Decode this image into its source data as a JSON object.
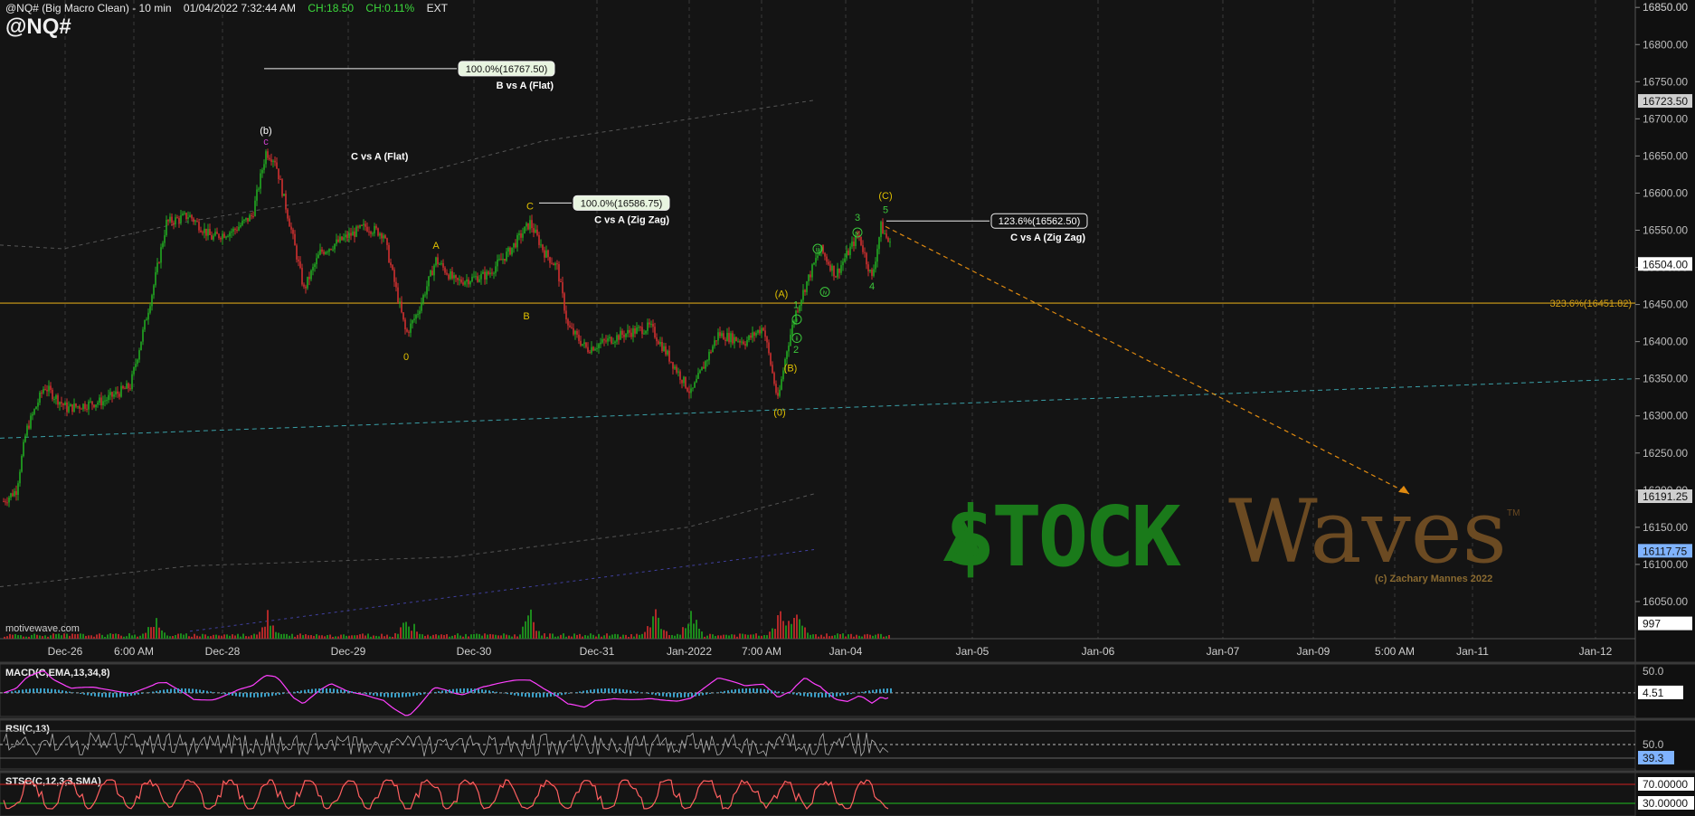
{
  "header": {
    "symbol_line": "@NQ# (Big Macro Clean) - 10 min",
    "datetime": "01/04/2022 7:32:44 AM",
    "change": "CH:18.50",
    "change_pct": "CH:0.11%",
    "session": "EXT",
    "symbol": "@NQ#"
  },
  "watermark": "motivewave.com",
  "logo": {
    "part1": "$TOCK",
    "part2": "Waves",
    "tm": "TM",
    "copyright": "(c) Zachary Mannes 2022"
  },
  "colors": {
    "background": "#141414",
    "up_candle": "#22aa22",
    "down_candle": "#d03030",
    "horizontal_level": "#d4a017",
    "projection": "#e08a10",
    "channel": "#3aa0a8",
    "label_yellow": "#e0c000",
    "label_green": "#3cc83c",
    "label_magenta": "#d040d0",
    "macd_line": "#ff40ff",
    "rsi_line": "#b0b0b0",
    "stoch_k": "#ff6060"
  },
  "chart_data": {
    "type": "candlestick",
    "instrument": "@NQ#",
    "timeframe": "10 min",
    "ylim": [
      16000,
      16860
    ],
    "y_ticks": [
      16050,
      16100,
      16150,
      16200,
      16250,
      16300,
      16350,
      16400,
      16450,
      16500,
      16550,
      16600,
      16650,
      16700,
      16750,
      16800,
      16850
    ],
    "x_ticks": [
      "Dec-26",
      "6:00 AM",
      "Dec-28",
      "Dec-29",
      "Dec-30",
      "Dec-31",
      "Jan-2022",
      "7:00 AM",
      "Jan-04",
      "Jan-05",
      "Jan-06",
      "Jan-07",
      "Jan-09",
      "5:00 AM",
      "Jan-11",
      "Jan-12"
    ],
    "price_tags": [
      {
        "text": "16850.00"
      },
      {
        "text": "16723.50"
      },
      {
        "text": "16504.00"
      },
      {
        "text": "16191.25"
      },
      {
        "text": "16117.75"
      },
      {
        "text": "997"
      }
    ],
    "path_points": [
      {
        "t": 0,
        "p": 16185
      },
      {
        "t": 14,
        "p": 16200
      },
      {
        "t": 25,
        "p": 16280
      },
      {
        "t": 45,
        "p": 16340
      },
      {
        "t": 70,
        "p": 16310
      },
      {
        "t": 110,
        "p": 16320
      },
      {
        "t": 140,
        "p": 16340
      },
      {
        "t": 165,
        "p": 16470
      },
      {
        "t": 180,
        "p": 16560
      },
      {
        "t": 205,
        "p": 16570
      },
      {
        "t": 230,
        "p": 16540
      },
      {
        "t": 255,
        "p": 16550
      },
      {
        "t": 275,
        "p": 16570
      },
      {
        "t": 290,
        "p": 16655
      },
      {
        "t": 300,
        "p": 16645
      },
      {
        "t": 318,
        "p": 16550
      },
      {
        "t": 332,
        "p": 16470
      },
      {
        "t": 350,
        "p": 16520
      },
      {
        "t": 378,
        "p": 16540
      },
      {
        "t": 400,
        "p": 16555
      },
      {
        "t": 420,
        "p": 16545
      },
      {
        "t": 445,
        "p": 16410
      },
      {
        "t": 458,
        "p": 16440
      },
      {
        "t": 478,
        "p": 16510
      },
      {
        "t": 500,
        "p": 16480
      },
      {
        "t": 535,
        "p": 16490
      },
      {
        "t": 558,
        "p": 16520
      },
      {
        "t": 582,
        "p": 16560
      },
      {
        "t": 598,
        "p": 16520
      },
      {
        "t": 612,
        "p": 16500
      },
      {
        "t": 624,
        "p": 16420
      },
      {
        "t": 645,
        "p": 16390
      },
      {
        "t": 685,
        "p": 16410
      },
      {
        "t": 715,
        "p": 16420
      },
      {
        "t": 745,
        "p": 16360
      },
      {
        "t": 760,
        "p": 16330
      },
      {
        "t": 790,
        "p": 16410
      },
      {
        "t": 820,
        "p": 16400
      },
      {
        "t": 840,
        "p": 16420
      },
      {
        "t": 856,
        "p": 16320
      },
      {
        "t": 866,
        "p": 16390
      },
      {
        "t": 876,
        "p": 16440
      },
      {
        "t": 888,
        "p": 16480
      },
      {
        "t": 903,
        "p": 16525
      },
      {
        "t": 920,
        "p": 16490
      },
      {
        "t": 945,
        "p": 16545
      },
      {
        "t": 960,
        "p": 16485
      },
      {
        "t": 970,
        "p": 16555
      },
      {
        "t": 980,
        "p": 16530
      }
    ],
    "horizontal_levels": [
      {
        "price": 16451.82,
        "label": "323.6%(16451.82)"
      }
    ],
    "fib_labels": [
      {
        "box": "100.0%(16767.50)",
        "sub": "B vs A (Flat)",
        "price": 16767.5
      },
      {
        "box": "100.0%(16586.75)",
        "sub": "C vs A (Zig Zag)",
        "price": 16586.75
      },
      {
        "box": "123.6%(16562.50)",
        "sub": "C vs A (Zig Zag)",
        "price": 16562.5
      }
    ],
    "annotations": [
      {
        "text": "C vs A (Flat)"
      }
    ],
    "wave_labels": [
      {
        "text": "(b)",
        "color": "white",
        "t": 290,
        "p": 16680
      },
      {
        "text": "c",
        "color": "magenta",
        "t": 290,
        "p": 16665
      },
      {
        "text": "A",
        "color": "yellow",
        "t": 478,
        "p": 16525
      },
      {
        "text": "B",
        "color": "yellow",
        "t": 578,
        "p": 16430
      },
      {
        "text": "C",
        "color": "yellow",
        "t": 582,
        "p": 16578
      },
      {
        "text": "0",
        "color": "yellow",
        "t": 445,
        "p": 16375
      },
      {
        "text": "(A)",
        "color": "yellow",
        "t": 860,
        "p": 16460
      },
      {
        "text": "(B)",
        "color": "yellow",
        "t": 870,
        "p": 16360
      },
      {
        "text": "(0)",
        "color": "yellow",
        "t": 858,
        "p": 16300
      },
      {
        "text": "(C)",
        "color": "yellow",
        "t": 975,
        "p": 16592
      },
      {
        "text": "1",
        "color": "green",
        "t": 876,
        "p": 16445
      },
      {
        "text": "2",
        "color": "green",
        "t": 876,
        "p": 16385
      },
      {
        "text": "3",
        "color": "green",
        "t": 944,
        "p": 16563
      },
      {
        "text": "4",
        "color": "green",
        "t": 960,
        "p": 16470
      },
      {
        "text": "5",
        "color": "green",
        "t": 975,
        "p": 16573
      }
    ],
    "circle_labels": [
      {
        "text": "i",
        "t": 877,
        "p": 16430
      },
      {
        "text": "ii",
        "t": 877,
        "p": 16405
      },
      {
        "text": "iii",
        "t": 900,
        "p": 16525
      },
      {
        "text": "iv",
        "t": 908,
        "p": 16467
      },
      {
        "text": "v",
        "t": 944,
        "p": 16547
      }
    ],
    "indicators": [
      {
        "name": "MACD(C,EMA,13,34,8)",
        "levels": [
          {
            "text": "50.0"
          },
          {
            "text": "4.51"
          }
        ]
      },
      {
        "name": "RSI(C,13)",
        "levels": [
          {
            "text": "50.0"
          },
          {
            "text": "39.3"
          }
        ]
      },
      {
        "name": "STSC(C,12,3,3,SMA)",
        "levels": [
          {
            "text": "70.00000"
          },
          {
            "text": "30.00000"
          }
        ]
      }
    ]
  }
}
